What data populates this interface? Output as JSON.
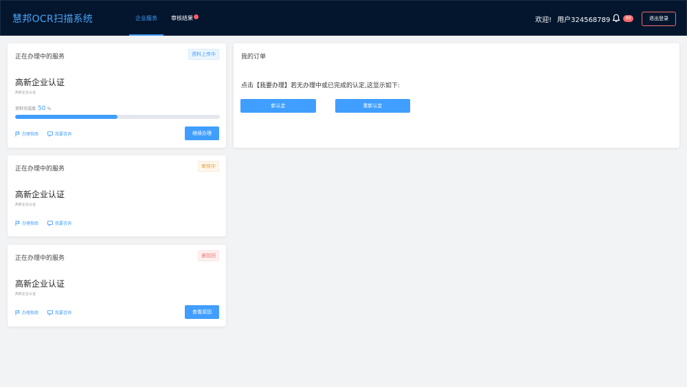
{
  "header": {
    "brand": "慧邦OCR扫描系统",
    "tabs": [
      {
        "label": "企业服务"
      },
      {
        "label": "审核结果"
      }
    ],
    "welcome": "欢迎!",
    "username": "用户324568789",
    "notification_count": "99",
    "logout_label": "退出登录"
  },
  "cards": [
    {
      "title": "正在办理中的服务",
      "tag": "资料上传中",
      "service_name": "高新企业认证",
      "service_sub": "高新企业认证",
      "progress_label": "资料完成度",
      "progress_value": "50",
      "progress_unit": "%",
      "progress_fraction": 0.5,
      "guide_label": "办理指南",
      "consult_label": "我要咨询",
      "action_label": "继续办理"
    },
    {
      "title": "正在办理中的服务",
      "tag": "审核中",
      "service_name": "高新企业认证",
      "service_sub": "高新企业认证",
      "guide_label": "办理指南",
      "consult_label": "我要咨询"
    },
    {
      "title": "正在办理中的服务",
      "tag": "被驳回",
      "service_name": "高新企业认证",
      "service_sub": "高新企业认证",
      "guide_label": "办理指南",
      "consult_label": "我要咨询",
      "action_label": "查看原因"
    }
  ],
  "orders": {
    "title": "我的订单",
    "instruction": "点击【我要办理】若无办理中或已完成的认定,这显示如下:",
    "new_label": "新认定",
    "renew_label": "重新认定"
  },
  "colors": {
    "header_bg": "#03162e",
    "accent": "#409eff",
    "danger": "#f56c6c",
    "warning": "#e6a23c"
  }
}
